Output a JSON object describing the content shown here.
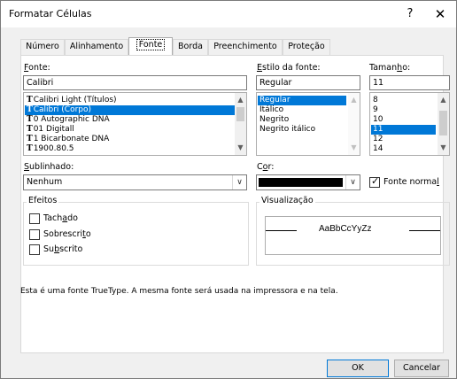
{
  "dialog": {
    "title": "Formatar Células",
    "help_label": "?",
    "close_label": "✕"
  },
  "tabs": [
    {
      "label": "Número"
    },
    {
      "label": "Alinhamento"
    },
    {
      "label": "Fonte"
    },
    {
      "label": "Borda"
    },
    {
      "label": "Preenchimento"
    },
    {
      "label": "Proteção"
    }
  ],
  "font": {
    "label_prefix": "",
    "label_key": "F",
    "label_rest": "onte:",
    "value": "Calibri",
    "items": [
      {
        "label": "Calibri Light (Títulos)"
      },
      {
        "label": "Calibri (Corpo)"
      },
      {
        "label": "0 Autographic DNA"
      },
      {
        "label": "01 Digitall"
      },
      {
        "label": "1 Bicarbonate DNA"
      },
      {
        "label": "1900.80.5"
      }
    ],
    "truetype_glyph": "T"
  },
  "style": {
    "label_key": "E",
    "label_rest": "stilo da fonte:",
    "value": "Regular",
    "items": [
      {
        "label": "Regular"
      },
      {
        "label": "Itálico"
      },
      {
        "label": "Negrito"
      },
      {
        "label": "Negrito itálico"
      }
    ]
  },
  "size": {
    "label_prefix": "Taman",
    "label_key": "h",
    "label_rest": "o:",
    "value": "11",
    "items": [
      {
        "label": "8"
      },
      {
        "label": "9"
      },
      {
        "label": "10"
      },
      {
        "label": "11"
      },
      {
        "label": "12"
      },
      {
        "label": "14"
      }
    ]
  },
  "underline": {
    "label_key": "S",
    "label_rest": "ublinhado:",
    "value": "Nenhum"
  },
  "color": {
    "label_prefix": "C",
    "label_key": "o",
    "label_rest": "r:",
    "swatch": "#000000",
    "normal_font_prefix": "Fonte norma",
    "normal_font_key": "l"
  },
  "effects": {
    "title": "Efeitos",
    "strike_prefix": "Tach",
    "strike_key": "a",
    "strike_rest": "do",
    "super_prefix": "Sobrescri",
    "super_key": "t",
    "super_rest": "o",
    "sub_prefix": "Su",
    "sub_key": "b",
    "sub_rest": "scrito"
  },
  "preview": {
    "title": "Visualização",
    "sample": "AaBbCcYyZz"
  },
  "info_text": "Esta é uma fonte TrueType. A mesma fonte será usada na impressora e na tela.",
  "buttons": {
    "ok": "OK",
    "cancel": "Cancelar"
  },
  "scroll": {
    "up": "▲",
    "down": "▼",
    "drop": "∨"
  }
}
